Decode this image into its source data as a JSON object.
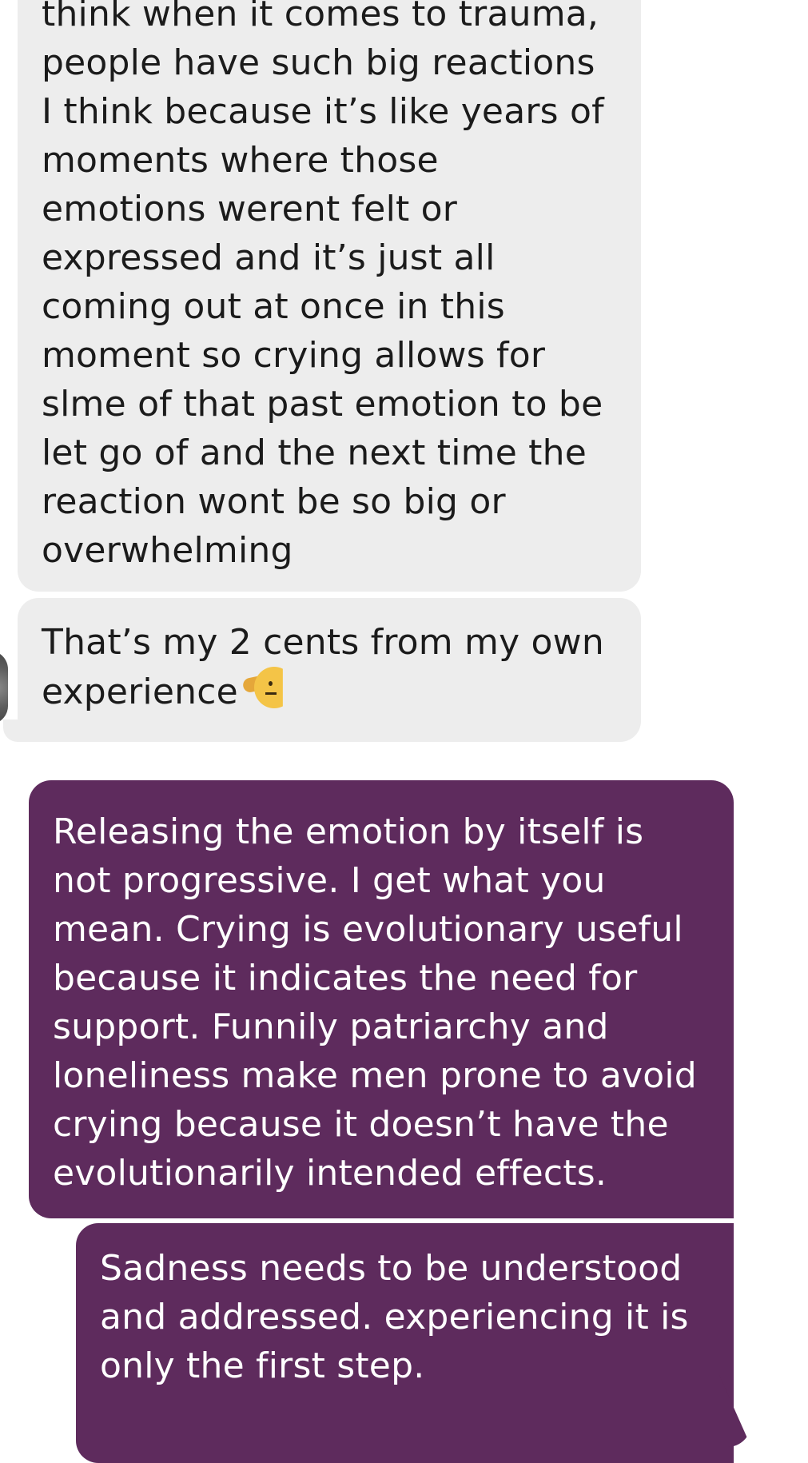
{
  "messages": [
    {
      "direction": "received",
      "text": "think when it comes to trauma,\npeople have such big reactions\nI think because it’s like years of\nmoments where those\nemotions werent felt or\nexpressed and it’s just all\ncoming out at once in this\nmoment so crying allows for\nslme of that past emotion to be\nlet go of and the next time the\nreaction wont be so big or\noverwhelming"
    },
    {
      "direction": "received",
      "text": "That’s my 2 cents from my own\nexperience",
      "emoji": "saluting-face-icon"
    },
    {
      "direction": "sent",
      "text": "Releasing the emotion by itself is\nnot progressive. I get what you\nmean. Crying is evolutionary useful\nbecause it indicates the need for\nsupport. Funnily patriarchy and\nloneliness make men prone to avoid\ncrying because it doesn’t have the\nevolutionarily intended effects."
    },
    {
      "direction": "sent",
      "text": "Sadness needs to be understood\nand addressed. experiencing it is\nonly the first step."
    }
  ],
  "colors": {
    "received_bubble": "#ededed",
    "received_text": "#1b1b1b",
    "sent_bubble": "#5e2b5d",
    "sent_text": "#ffffff",
    "background": "#ffffff"
  }
}
